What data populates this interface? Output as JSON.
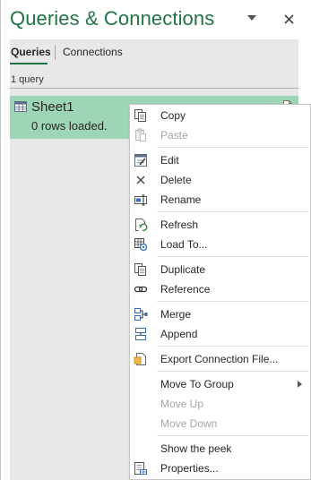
{
  "pane": {
    "title": "Queries & Connections",
    "tabs": [
      {
        "label": "Queries",
        "active": true
      },
      {
        "label": "Connections",
        "active": false
      }
    ],
    "query_count": "1 query"
  },
  "query": {
    "name": "Sheet1",
    "status": "0 rows loaded."
  },
  "context_menu": {
    "copy": "Copy",
    "paste": "Paste",
    "edit": "Edit",
    "delete": "Delete",
    "rename": "Rename",
    "refresh": "Refresh",
    "load_to": "Load To...",
    "duplicate": "Duplicate",
    "reference": "Reference",
    "merge": "Merge",
    "append": "Append",
    "export": "Export Connection File...",
    "move_to_group": "Move To Group",
    "move_up": "Move Up",
    "move_down": "Move Down",
    "show_peek": "Show the peek",
    "properties": "Properties..."
  },
  "colors": {
    "brand": "#217346",
    "selected_item": "#9fd5b7",
    "disabled_text": "#a6a6a6"
  }
}
